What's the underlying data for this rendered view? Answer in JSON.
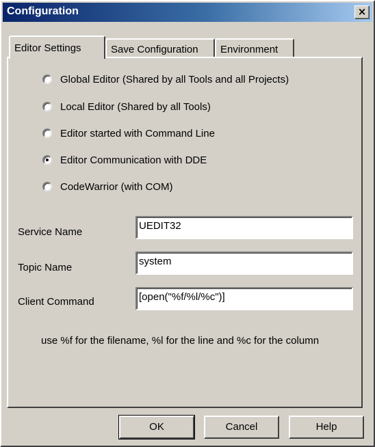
{
  "window": {
    "title": "Configuration",
    "close_glyph": "×"
  },
  "tabs": [
    {
      "label": "Editor Settings",
      "active": true
    },
    {
      "label": "Save Configuration",
      "active": false
    },
    {
      "label": "Environment",
      "active": false
    }
  ],
  "editor_settings": {
    "options": [
      {
        "label": "Global Editor (Shared by all Tools and all Projects)",
        "selected": false
      },
      {
        "label": "Local Editor (Shared by all Tools)",
        "selected": false
      },
      {
        "label": "Editor started with Command Line",
        "selected": false
      },
      {
        "label": "Editor Communication with DDE",
        "selected": true
      },
      {
        "label": "CodeWarrior (with COM)",
        "selected": false
      }
    ],
    "service_name": {
      "label": "Service Name",
      "value": "UEDIT32"
    },
    "topic_name": {
      "label": "Topic Name",
      "value": "system"
    },
    "client_command": {
      "label": "Client Command",
      "value": "[open(\"%f/%l/%c\")]"
    },
    "hint": "use %f for the filename, %l for the line and %c for the column"
  },
  "buttons": {
    "ok": "OK",
    "cancel": "Cancel",
    "help": "Help"
  }
}
